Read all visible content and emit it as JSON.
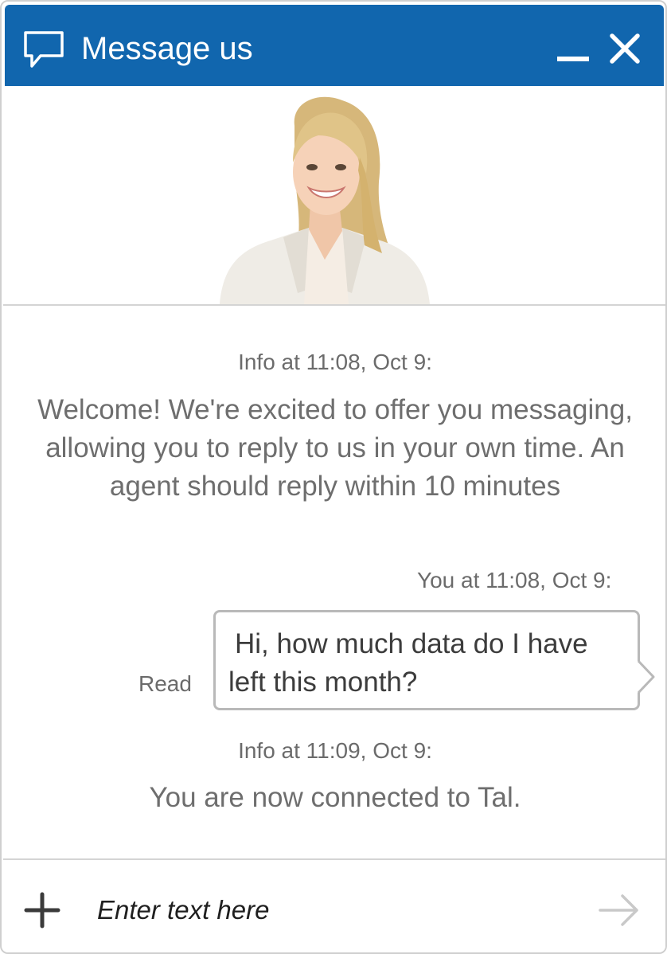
{
  "header": {
    "title": "Message us",
    "icon": "chat-bubble-icon",
    "minimize_icon": "minimize-icon",
    "close_icon": "close-icon",
    "background_color": "#1166ae"
  },
  "agent": {
    "photo_icon": "agent-portrait"
  },
  "transcript": [
    {
      "type": "info",
      "meta": "Info at 11:08, Oct 9:",
      "text": "Welcome! We're excited to offer you messaging, allowing you to reply to us in your own time. An agent should reply within 10 minutes"
    },
    {
      "type": "visitor",
      "meta": "You at 11:08, Oct 9:",
      "text": "Hi, how much data do I have left this month?",
      "status": "Read"
    },
    {
      "type": "info",
      "meta": "Info at 11:09, Oct 9:",
      "text": "You are now connected to Tal."
    }
  ],
  "composer": {
    "placeholder": "Enter text here",
    "value": "",
    "add_icon": "plus-icon",
    "send_icon": "arrow-right-icon"
  }
}
